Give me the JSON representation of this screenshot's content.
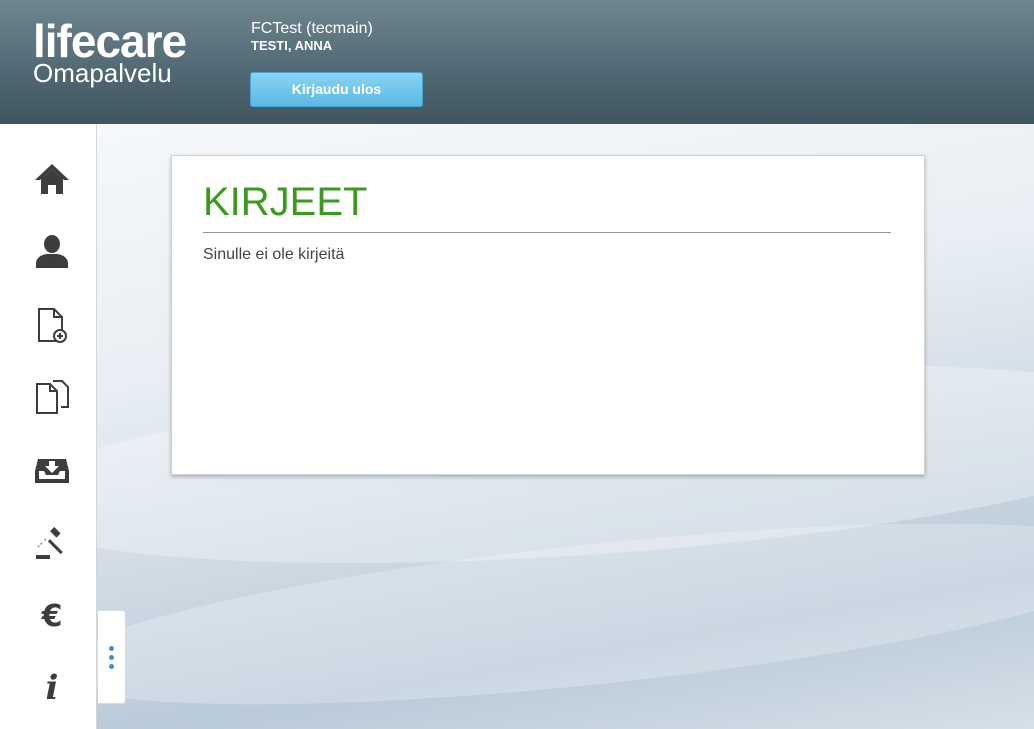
{
  "header": {
    "logo_main": "lifecare",
    "logo_sub": "Omapalvelu",
    "org": "FCTest (tecmain)",
    "user": "TESTI, ANNA",
    "logout_label": "Kirjaudu ulos"
  },
  "sidebar": {
    "items": [
      {
        "icon": "home-icon"
      },
      {
        "icon": "person-icon"
      },
      {
        "icon": "new-document-icon"
      },
      {
        "icon": "documents-icon"
      },
      {
        "icon": "inbox-icon"
      },
      {
        "icon": "gavel-icon"
      },
      {
        "icon": "euro-icon"
      },
      {
        "icon": "info-icon"
      }
    ]
  },
  "main": {
    "title": "KIRJEET",
    "message": "Sinulle ei ole kirjeitä"
  },
  "colors": {
    "header": "#526a75",
    "accent_green": "#3a9a1d",
    "logout_button": "#6cc2ea",
    "icon": "#3d3d3d"
  }
}
